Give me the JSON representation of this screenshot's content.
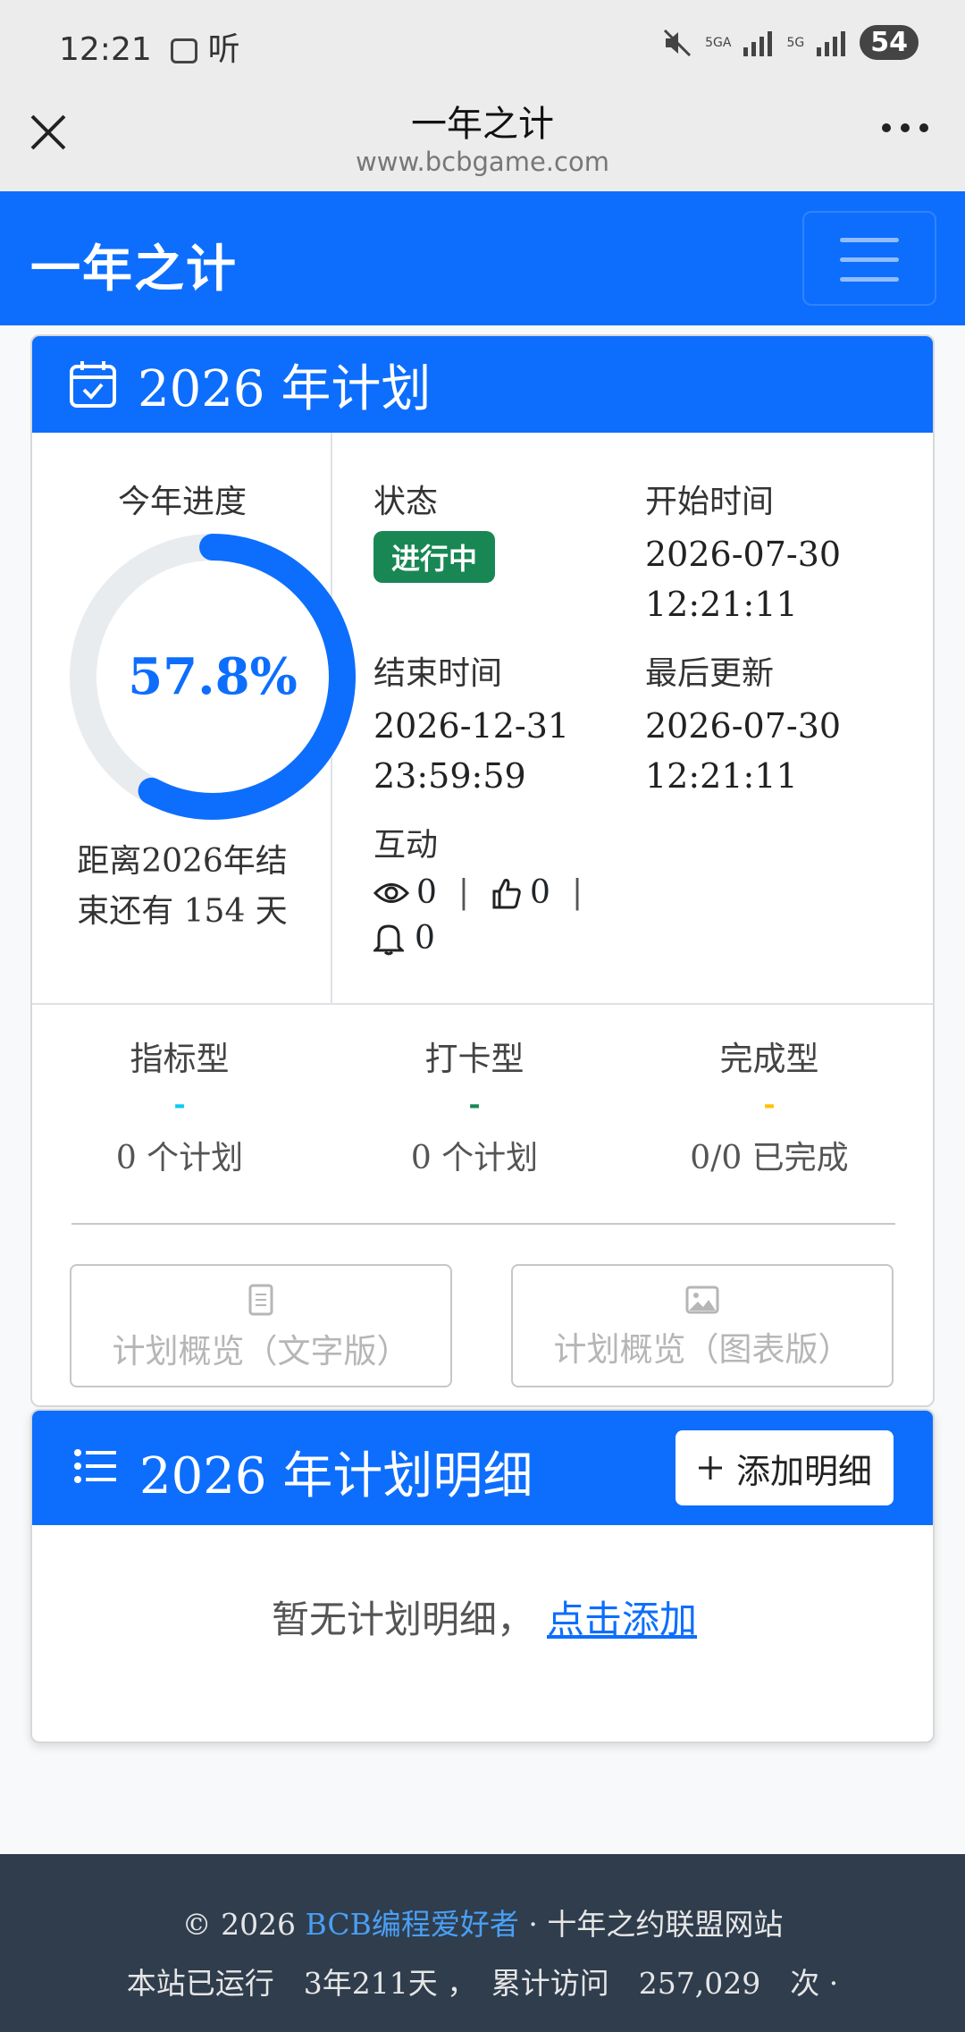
{
  "status_bar": {
    "time": "12:21",
    "listen": "听",
    "network_a": "5GA",
    "network_b": "5G",
    "battery": "54"
  },
  "browser": {
    "title": "一年之计",
    "url": "www.bcbgame.com"
  },
  "navbar": {
    "brand": "一年之计"
  },
  "plan_card": {
    "title": "2026 年计划",
    "progress_label": "今年进度",
    "progress_value": "57.8%",
    "progress_fraction": 0.578,
    "countdown_line1": "距离2026年结",
    "countdown_line2": "束还有 154 天",
    "status_label": "状态",
    "status_badge": "进行中",
    "start_label": "开始时间",
    "start_date": "2026-07-30",
    "start_time": "12:21:11",
    "end_label": "结束时间",
    "end_date": "2026-12-31",
    "end_time": "23:59:59",
    "updated_label": "最后更新",
    "updated_date": "2026-07-30",
    "updated_time": "12:21:11",
    "interaction_label": "互动",
    "views": "0",
    "likes": "0",
    "subscriptions": "0",
    "separator": "|"
  },
  "plan_types": [
    {
      "name": "指标型",
      "dash": "-",
      "count": "0 个计划",
      "color": "#0dcaf0"
    },
    {
      "name": "打卡型",
      "dash": "-",
      "count": "0 个计划",
      "color": "#198754"
    },
    {
      "name": "完成型",
      "dash": "-",
      "count": "0/0 已完成",
      "color": "#ffc107"
    }
  ],
  "overview": {
    "text_btn": "计划概览（文字版）",
    "chart_btn": "计划概览（图表版）"
  },
  "detail_card": {
    "title": "2026 年计划明细",
    "add_btn": "添加明细",
    "empty_text": "暂无计划明细，",
    "empty_link": "点击添加"
  },
  "footer": {
    "copyright": "© 2026 ",
    "site_name": "BCB编程爱好者",
    "suffix": " · 十年之约联盟网站",
    "running_line": "本站已运行　3年211天 ，　累计访问　257,029　次 ·"
  },
  "colors": {
    "primary": "#0d6efd",
    "success": "#198754",
    "footer_bg": "#2f3d4d"
  }
}
